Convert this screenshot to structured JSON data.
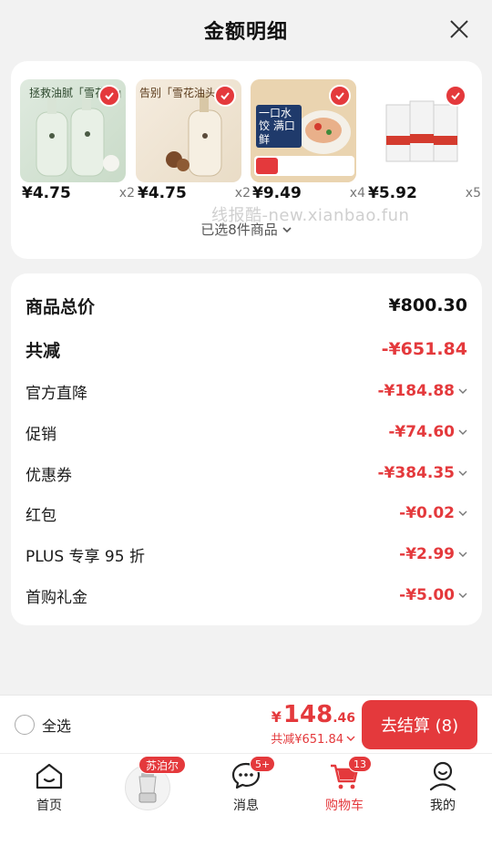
{
  "header": {
    "title": "金额明细"
  },
  "products": [
    {
      "price": "¥4.75",
      "qty": "x2",
      "img_text": "拯救油腻「雪花头」"
    },
    {
      "price": "¥4.75",
      "qty": "x2",
      "img_text": "告别「雪花油头」"
    },
    {
      "price": "¥9.49",
      "qty": "x4",
      "img_text": "一口水饺 满口鲜"
    },
    {
      "price": "¥5.92",
      "qty": "x5",
      "img_text": ""
    }
  ],
  "selected_text": "已选8件商品",
  "watermark": "线报酷-new.xianbao.fun",
  "summary": {
    "total": {
      "label": "商品总价",
      "value": "¥800.30"
    },
    "saved": {
      "label": "共减",
      "value": "-¥651.84"
    },
    "items": [
      {
        "label": "官方直降",
        "value": "-¥184.88"
      },
      {
        "label": "促销",
        "value": "-¥74.60"
      },
      {
        "label": "优惠券",
        "value": "-¥384.35"
      },
      {
        "label": "红包",
        "value": "-¥0.02"
      },
      {
        "label": "PLUS 专享 95 折",
        "value": "-¥2.99"
      },
      {
        "label": "首购礼金",
        "value": "-¥5.00"
      }
    ]
  },
  "bottom": {
    "select_all": "全选",
    "currency": "¥",
    "total_int": "148",
    "total_dec": ".46",
    "saved_text": "共减¥651.84",
    "checkout_label": "去结算 (8)"
  },
  "tabs": {
    "home": "首页",
    "brand_badge": "苏泊尔",
    "messages": "消息",
    "messages_badge": "5+",
    "cart": "购物车",
    "cart_badge": "13",
    "me": "我的"
  },
  "colors": {
    "accent": "#e4393c"
  }
}
